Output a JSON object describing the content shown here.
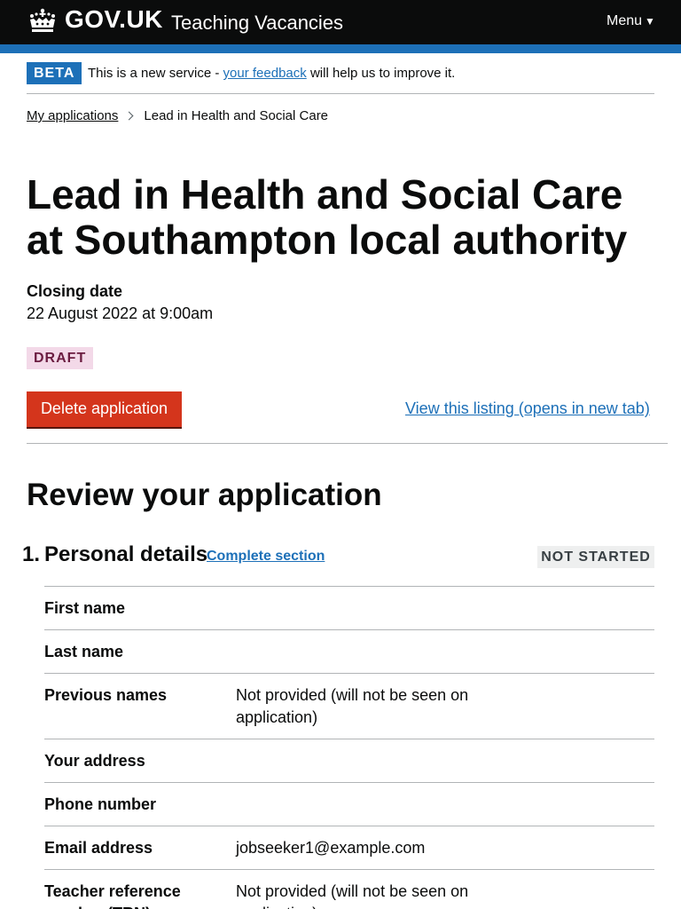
{
  "header": {
    "logo": "GOV.UK",
    "service_name": "Teaching Vacancies",
    "menu_label": "Menu",
    "crown_icon": "crown-icon",
    "menu_icon": "caret-down-icon"
  },
  "phase_banner": {
    "tag": "BETA",
    "text_before": "This is a new service - ",
    "link_text": "your feedback",
    "text_after": " will help us to improve it."
  },
  "breadcrumbs": {
    "items": [
      "My applications",
      "Lead in Health and Social Care"
    ],
    "separator_icon": "chevron-right-icon"
  },
  "page": {
    "title": "Lead in Health and Social Care at Southampton local authority",
    "closing_label": "Closing date",
    "closing_value": "22 August 2022 at 9:00am",
    "status_tag": "DRAFT",
    "delete_button": "Delete application",
    "view_listing_link": "View this listing (opens in new tab)",
    "review_heading": "Review your application"
  },
  "section": {
    "number": "1.",
    "title": "Personal details",
    "link": "Complete section",
    "status": "NOT STARTED",
    "rows": [
      {
        "label": "First name",
        "value": ""
      },
      {
        "label": "Last name",
        "value": ""
      },
      {
        "label": "Previous names",
        "value": "Not provided (will not be seen on application)"
      },
      {
        "label": "Your address",
        "value": ""
      },
      {
        "label": "Phone number",
        "value": ""
      },
      {
        "label": "Email address",
        "value": "jobseeker1@example.com"
      },
      {
        "label": "Teacher reference number (TRN)",
        "value": "Not provided (will not be seen on application)"
      }
    ]
  },
  "colors": {
    "header_bg": "#0b0c0c",
    "brand_blue": "#1d70b8",
    "delete_red": "#d4351c",
    "draft_tag_bg": "#f3d9e8",
    "status_tag_bg": "#eeefef"
  }
}
